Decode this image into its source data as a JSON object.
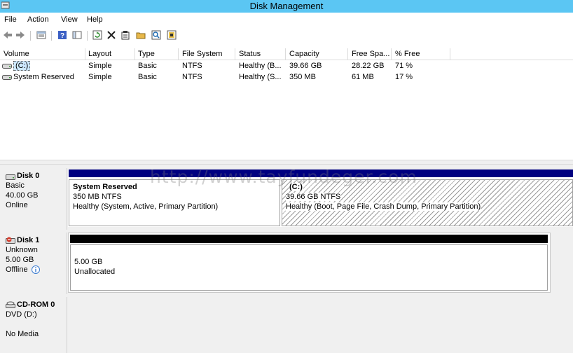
{
  "window": {
    "title": "Disk Management"
  },
  "menu": [
    "File",
    "Action",
    "View",
    "Help"
  ],
  "toolbar": {
    "buttons": [
      "back-icon",
      "forward-icon",
      "properties-view-icon",
      "help-icon",
      "console-view-icon",
      "refresh-icon",
      "delete-icon",
      "properties-icon",
      "open-icon",
      "search-icon",
      "rescan-icon"
    ]
  },
  "volume_list": {
    "columns": [
      "Volume",
      "Layout",
      "Type",
      "File System",
      "Status",
      "Capacity",
      "Free Spa...",
      "% Free"
    ],
    "rows": [
      {
        "volume": "(C:)",
        "layout": "Simple",
        "type": "Basic",
        "fs": "NTFS",
        "status": "Healthy (B...",
        "capacity": "39.66 GB",
        "free": "28.22 GB",
        "pct": "71 %"
      },
      {
        "volume": "System Reserved",
        "layout": "Simple",
        "type": "Basic",
        "fs": "NTFS",
        "status": "Healthy (S...",
        "capacity": "350 MB",
        "free": "61 MB",
        "pct": "17 %"
      }
    ]
  },
  "disks": [
    {
      "name": "Disk 0",
      "type": "Basic",
      "size": "40.00 GB",
      "state": "Online",
      "partitions": [
        {
          "title": "System Reserved",
          "size": "350 MB NTFS",
          "status": "Healthy (System, Active, Primary Partition)"
        },
        {
          "title": "(C:)",
          "size": "39.66 GB NTFS",
          "status": "Healthy (Boot, Page File, Crash Dump, Primary Partition)"
        }
      ]
    },
    {
      "name": "Disk 1",
      "type": "Unknown",
      "size": "5.00 GB",
      "state": "Offline",
      "partitions": [
        {
          "size": "5.00 GB",
          "status": "Unallocated"
        }
      ]
    },
    {
      "name": "CD-ROM 0",
      "type": "DVD (D:)",
      "state": "No Media"
    }
  ],
  "watermark": "http://www.tayfundeger.com",
  "colors": {
    "titlebar": "#5bc6f3",
    "primary_partition": "#000080",
    "unallocated": "#000000"
  }
}
